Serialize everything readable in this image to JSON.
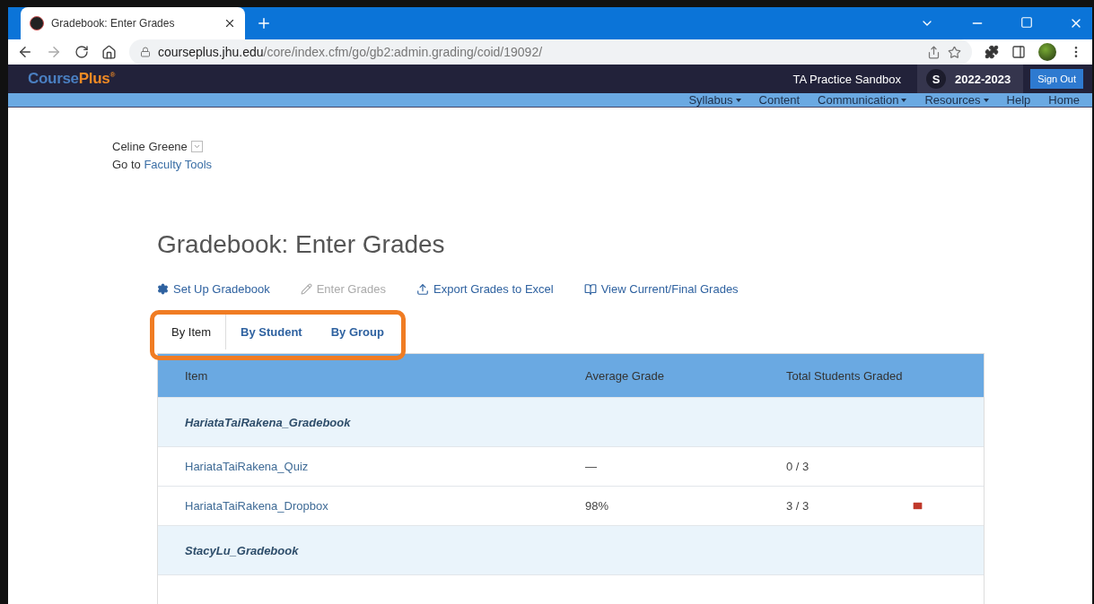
{
  "browser": {
    "tab_title": "Gradebook: Enter Grades",
    "url_host": "courseplus.jhu.edu",
    "url_path": "/core/index.cfm/go/gb2:admin.grading/coid/19092/"
  },
  "site": {
    "logo_a": "Course",
    "logo_b": "Plus",
    "logo_mark": "®",
    "course": "TA Practice Sandbox",
    "avatar": "S",
    "year": "2022-2023",
    "sign_out": "Sign Out"
  },
  "nav": [
    {
      "label": "Syllabus",
      "dropdown": true
    },
    {
      "label": "Content",
      "dropdown": false
    },
    {
      "label": "Communication",
      "dropdown": true
    },
    {
      "label": "Resources",
      "dropdown": true
    },
    {
      "label": "Help",
      "dropdown": false
    },
    {
      "label": "Home",
      "dropdown": false
    }
  ],
  "user": {
    "name": "Celine Greene",
    "goto": "Go to",
    "goto_link": "Faculty Tools"
  },
  "title": "Gradebook: Enter Grades",
  "actions": [
    {
      "label": "Set Up Gradebook",
      "disabled": false
    },
    {
      "label": "Enter Grades",
      "disabled": true
    },
    {
      "label": "Export Grades to Excel",
      "disabled": false
    },
    {
      "label": "View Current/Final Grades",
      "disabled": false
    }
  ],
  "tabs": [
    {
      "label": "By Item",
      "selected": true
    },
    {
      "label": "By Student",
      "selected": false
    },
    {
      "label": "By Group",
      "selected": false
    }
  ],
  "tabs_highlighted": true,
  "table": {
    "columns": [
      "Item",
      "Average Grade",
      "Total Students Graded"
    ],
    "rows": [
      {
        "kind": "group",
        "item": "HariataTaiRakena_Gradebook"
      },
      {
        "kind": "item",
        "item": "HariataTaiRakena_Quiz",
        "average": "—",
        "graded": "0 / 3",
        "message": false
      },
      {
        "kind": "item",
        "item": "HariataTaiRakena_Dropbox",
        "average": "98%",
        "graded": "3 / 3",
        "message": true
      },
      {
        "kind": "group",
        "item": "StacyLu_Gradebook"
      }
    ]
  }
}
